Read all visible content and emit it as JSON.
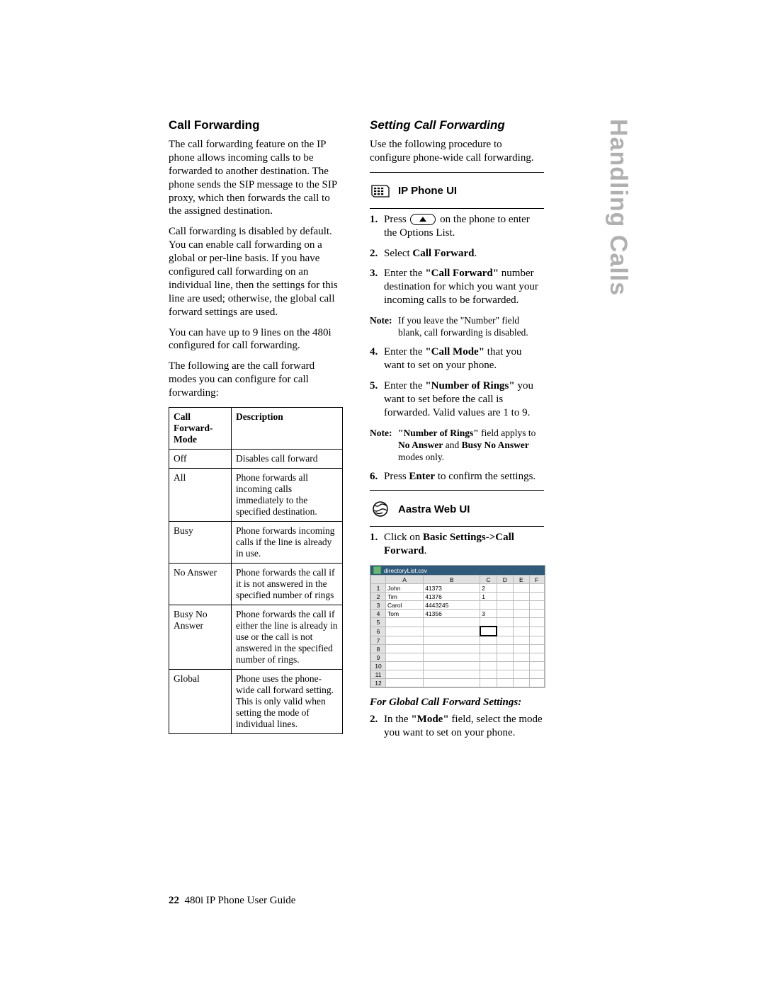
{
  "tab": "Handling Calls",
  "left": {
    "heading": "Call Forwarding",
    "p1": "The call forwarding feature on the IP phone allows incoming calls to be forwarded to another destination. The phone sends the SIP message to the SIP proxy, which then forwards the call to the assigned destination.",
    "p2": "Call forwarding is disabled by default. You can enable call forwarding on a global or per-line basis. If you have configured call forwarding on an individual line, then the settings for this line are used; otherwise, the global call forward settings are used.",
    "p3": "You can have up to 9 lines on the 480i configured for call forwarding.",
    "p4": "The following are the call forward modes you can configure for call forwarding:",
    "table": {
      "th1": "Call Forward-Mode",
      "th2": "Description",
      "rows": [
        {
          "mode": "Off",
          "desc": "Disables call forward"
        },
        {
          "mode": "All",
          "desc": "Phone forwards all incoming calls immediately to the specified destination."
        },
        {
          "mode": "Busy",
          "desc": "Phone forwards incoming calls if the line is already in use."
        },
        {
          "mode": "No Answer",
          "desc": "Phone forwards the call if it is not answered in the specified number of rings"
        },
        {
          "mode": "Busy No Answer",
          "desc": "Phone forwards the call if either the line is already in use or the call is not answered in the specified number of rings."
        },
        {
          "mode": "Global",
          "desc": "Phone uses the phone-wide call forward setting. This is only valid when setting the mode of individual lines."
        }
      ]
    }
  },
  "right": {
    "heading": "Setting Call Forwarding",
    "p1": "Use the following procedure to configure phone-wide call forwarding.",
    "ipui": "IP Phone UI",
    "steps1": {
      "s1a": "Press ",
      "s1b": " on the phone to enter the Options List.",
      "s2a": "Select ",
      "s2b": "Call Forward",
      "s2c": ".",
      "s3a": "Enter the ",
      "s3b": "\"Call Forward\"",
      "s3c": " number destination for which you want your incoming calls to be forwarded.",
      "note1_label": "Note:",
      "note1_text": " If you leave the \"Number\" field blank, call forwarding is disabled.",
      "s4a": "Enter the ",
      "s4b": "\"Call Mode\"",
      "s4c": " that you want to set on your phone.",
      "s5a": "Enter the ",
      "s5b": "\"Number of Rings\"",
      "s5c": " you want to set before the call is forwarded. Valid values are 1 to 9.",
      "note2_label": "Note:",
      "note2_a": " \"Number of Rings\"",
      "note2_b": " field applys to ",
      "note2_c": "No Answer",
      "note2_d": " and ",
      "note2_e": "Busy No Answer",
      "note2_f": " modes only.",
      "s6a": "Press ",
      "s6b": "Enter",
      "s6c": " to confirm the settings."
    },
    "webui": "Aastra Web UI",
    "web_s1a": "Click on ",
    "web_s1b": "Basic Settings->Call Forward",
    "web_s1c": ".",
    "csv": {
      "title": "directoryList.csv",
      "cols": [
        "A",
        "B",
        "C",
        "D",
        "E",
        "F"
      ],
      "rows": [
        {
          "n": "1",
          "a": "John",
          "b": "41373",
          "c": "2",
          "d": "",
          "e": "",
          "f": ""
        },
        {
          "n": "2",
          "a": "Tim",
          "b": "41376",
          "c": "1",
          "d": "",
          "e": "",
          "f": ""
        },
        {
          "n": "3",
          "a": "Carol",
          "b": "4443245",
          "c": "",
          "d": "",
          "e": "",
          "f": ""
        },
        {
          "n": "4",
          "a": "Tom",
          "b": "41356",
          "c": "3",
          "d": "",
          "e": "",
          "f": ""
        },
        {
          "n": "5",
          "a": "",
          "b": "",
          "c": "",
          "d": "",
          "e": "",
          "f": ""
        },
        {
          "n": "6",
          "a": "",
          "b": "",
          "c": "",
          "d": "",
          "e": "",
          "f": ""
        },
        {
          "n": "7",
          "a": "",
          "b": "",
          "c": "",
          "d": "",
          "e": "",
          "f": ""
        },
        {
          "n": "8",
          "a": "",
          "b": "",
          "c": "",
          "d": "",
          "e": "",
          "f": ""
        },
        {
          "n": "9",
          "a": "",
          "b": "",
          "c": "",
          "d": "",
          "e": "",
          "f": ""
        },
        {
          "n": "10",
          "a": "",
          "b": "",
          "c": "",
          "d": "",
          "e": "",
          "f": ""
        },
        {
          "n": "11",
          "a": "",
          "b": "",
          "c": "",
          "d": "",
          "e": "",
          "f": ""
        },
        {
          "n": "12",
          "a": "",
          "b": "",
          "c": "",
          "d": "",
          "e": "",
          "f": ""
        }
      ]
    },
    "global_heading": "For Global Call Forward Settings:",
    "g_s2a": "In the ",
    "g_s2b": "\"Mode\"",
    "g_s2c": " field, select the mode you want to set on your phone."
  },
  "footer": {
    "page": "22",
    "title": "480i IP Phone User Guide"
  }
}
